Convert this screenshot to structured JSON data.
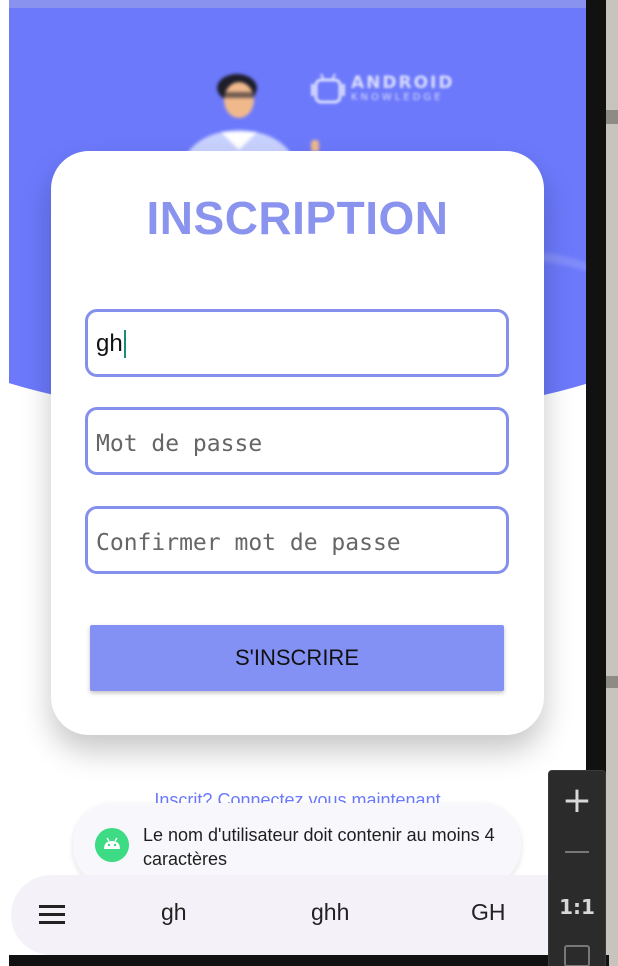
{
  "colors": {
    "primary": "#6c79fb",
    "title": "#8a94ee",
    "field_border": "#8490ec",
    "button": "#8491f4",
    "toast_bg": "#f8f7fc",
    "android_green": "#3ddc84"
  },
  "header": {
    "logo_text": "ANDROID",
    "logo_subtext": "KNOWLEDGE"
  },
  "form": {
    "title": "INSCRIPTION",
    "username_value": "gh",
    "password_placeholder": "Mot de passe",
    "confirm_placeholder": "Confirmer mot de passe",
    "submit_label": "S'INSCRIRE"
  },
  "login_link": "Inscrit? Connectez vous maintenant",
  "toast": {
    "icon": "android-icon",
    "message": "Le nom d'utilisateur doit contenir au moins 4 caractères"
  },
  "keyboard": {
    "menu_icon": "menu-icon",
    "suggestions": [
      "gh",
      "ghh",
      "GH"
    ]
  },
  "emulator_zoom": {
    "zoom_in": "+",
    "actual_size": "1:1"
  }
}
